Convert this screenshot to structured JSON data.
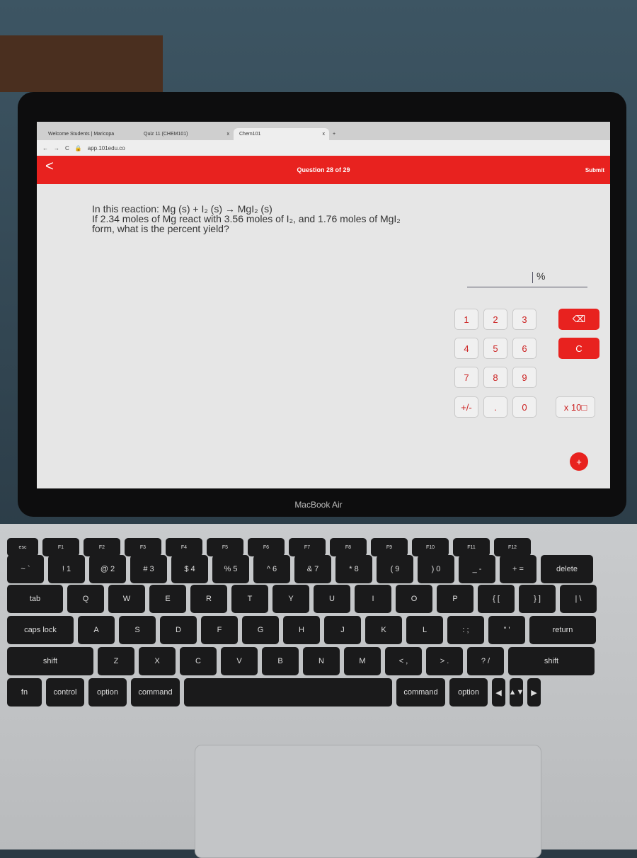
{
  "browser": {
    "tabs": [
      {
        "label": "Welcome Students | Maricopa"
      },
      {
        "label": "Quiz 11 (CHEM101)"
      },
      {
        "label": "Chem101"
      }
    ],
    "new_tab": "+",
    "close": "x",
    "url": "app.101edu.co"
  },
  "header": {
    "back": "<",
    "title": "Question 28 of 29",
    "submit": "Submit"
  },
  "question": {
    "line1": "In this reaction: Mg (s) + I₂ (s) → MgI₂ (s)",
    "line2": "If 2.34 moles of Mg react with 3.56 moles of I₂, and 1.76 moles of MgI₂",
    "line3": "form, what is the percent yield?"
  },
  "answer": {
    "value": "",
    "unit": "%"
  },
  "keypad": {
    "keys": [
      "1",
      "2",
      "3",
      "4",
      "5",
      "6",
      "7",
      "8",
      "9",
      "+/-",
      ".",
      "0"
    ],
    "backspace": "⌫",
    "clear": "C",
    "sci": "x 10□",
    "plus": "+"
  },
  "laptop_brand": "MacBook Air",
  "keyboard": {
    "rows": [
      [
        "esc",
        "F1",
        "F2",
        "F3",
        "F4",
        "F5",
        "F6",
        "F7",
        "F8",
        "F9",
        "F10",
        "F11",
        "F12"
      ],
      [
        "~ `",
        "! 1",
        "@ 2",
        "# 3",
        "$ 4",
        "% 5",
        "^ 6",
        "& 7",
        "* 8",
        "( 9",
        ") 0",
        "_ -",
        "+ =",
        "delete"
      ],
      [
        "tab",
        "Q",
        "W",
        "E",
        "R",
        "T",
        "Y",
        "U",
        "I",
        "O",
        "P",
        "{ [",
        "} ]",
        "| \\"
      ],
      [
        "caps lock",
        "A",
        "S",
        "D",
        "F",
        "G",
        "H",
        "J",
        "K",
        "L",
        ": ;",
        "\" '",
        "return"
      ],
      [
        "shift",
        "Z",
        "X",
        "C",
        "V",
        "B",
        "N",
        "M",
        "< ,",
        "> .",
        "? /",
        "shift"
      ],
      [
        "fn",
        "control",
        "option",
        "command",
        "",
        "command",
        "option",
        "◀",
        "▲▼",
        "▶"
      ]
    ]
  },
  "colors": {
    "accent": "#e8221f"
  }
}
